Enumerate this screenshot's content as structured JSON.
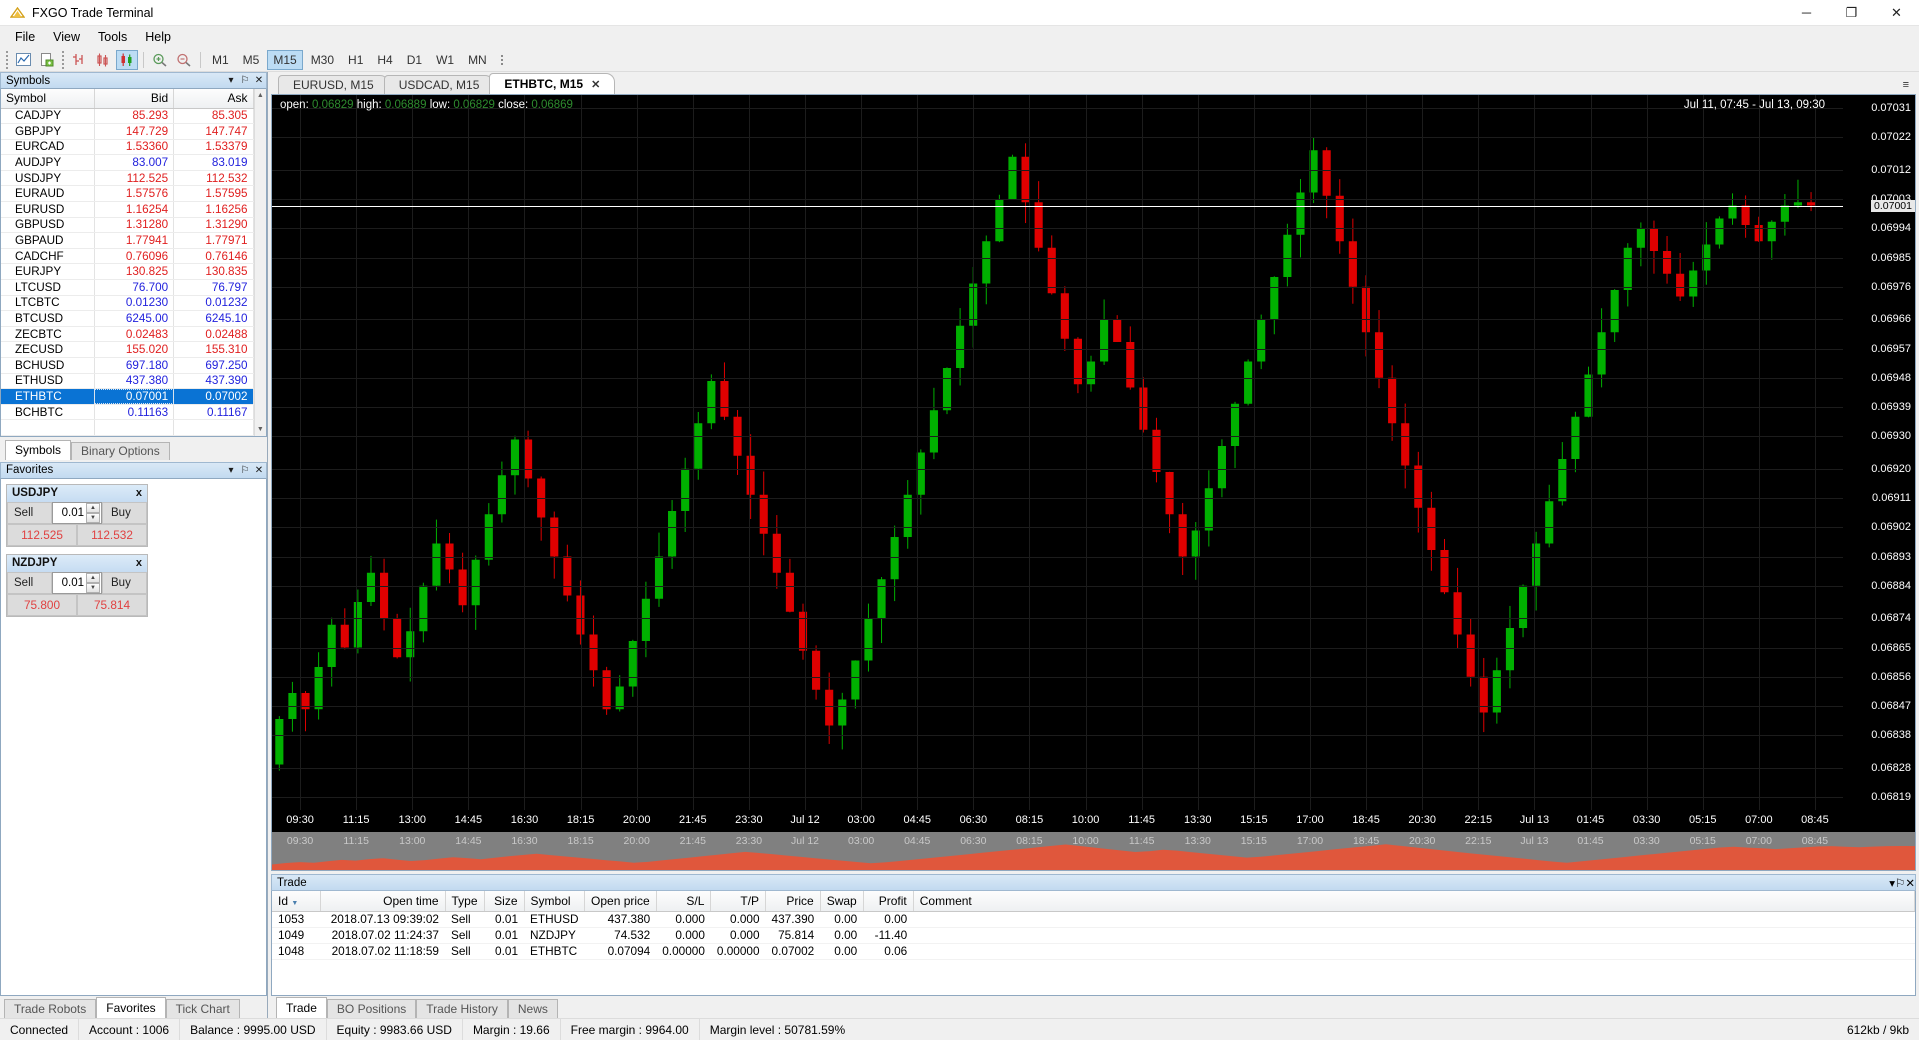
{
  "window": {
    "title": "FXGO Trade Terminal",
    "minimize": "─",
    "maximize": "❐",
    "close": "✕"
  },
  "menu": {
    "items": [
      "File",
      "View",
      "Tools",
      "Help"
    ]
  },
  "toolbar": {
    "chart_icon": "chart-icon",
    "new_chart_icon": "new-chart-icon",
    "bar_chart_icon": "bar-chart-icon",
    "line_chart_icon": "line-chart-icon",
    "candle_chart_icon": "candlestick-icon",
    "zoom_in_icon": "zoom-in-icon",
    "zoom_out_icon": "zoom-out-icon",
    "timeframes": [
      "M1",
      "M5",
      "M15",
      "M30",
      "H1",
      "H4",
      "D1",
      "W1",
      "MN"
    ],
    "active_timeframe": "M15"
  },
  "symbols_panel": {
    "title": "Symbols",
    "collapse": "▾",
    "pin": "⚐",
    "close": "✕",
    "columns": [
      "Symbol",
      "Bid",
      "Ask"
    ],
    "selected": "ETHBTC",
    "rows": [
      {
        "symbol": "CADJPY",
        "bid": "85.293",
        "ask": "85.305",
        "bid_dir": "down",
        "ask_dir": "down"
      },
      {
        "symbol": "GBPJPY",
        "bid": "147.729",
        "ask": "147.747",
        "bid_dir": "down",
        "ask_dir": "down"
      },
      {
        "symbol": "EURCAD",
        "bid": "1.53360",
        "ask": "1.53379",
        "bid_dir": "down",
        "ask_dir": "down"
      },
      {
        "symbol": "AUDJPY",
        "bid": "83.007",
        "ask": "83.019",
        "bid_dir": "up",
        "ask_dir": "up"
      },
      {
        "symbol": "USDJPY",
        "bid": "112.525",
        "ask": "112.532",
        "bid_dir": "down",
        "ask_dir": "down"
      },
      {
        "symbol": "EURAUD",
        "bid": "1.57576",
        "ask": "1.57595",
        "bid_dir": "down",
        "ask_dir": "down"
      },
      {
        "symbol": "EURUSD",
        "bid": "1.16254",
        "ask": "1.16256",
        "bid_dir": "down",
        "ask_dir": "down"
      },
      {
        "symbol": "GBPUSD",
        "bid": "1.31280",
        "ask": "1.31290",
        "bid_dir": "down",
        "ask_dir": "down"
      },
      {
        "symbol": "GBPAUD",
        "bid": "1.77941",
        "ask": "1.77971",
        "bid_dir": "down",
        "ask_dir": "down"
      },
      {
        "symbol": "CADCHF",
        "bid": "0.76096",
        "ask": "0.76146",
        "bid_dir": "down",
        "ask_dir": "down"
      },
      {
        "symbol": "EURJPY",
        "bid": "130.825",
        "ask": "130.835",
        "bid_dir": "down",
        "ask_dir": "down"
      },
      {
        "symbol": "LTCUSD",
        "bid": "76.700",
        "ask": "76.797",
        "bid_dir": "up",
        "ask_dir": "up"
      },
      {
        "symbol": "LTCBTC",
        "bid": "0.01230",
        "ask": "0.01232",
        "bid_dir": "up",
        "ask_dir": "up"
      },
      {
        "symbol": "BTCUSD",
        "bid": "6245.00",
        "ask": "6245.10",
        "bid_dir": "up",
        "ask_dir": "up"
      },
      {
        "symbol": "ZECBTC",
        "bid": "0.02483",
        "ask": "0.02488",
        "bid_dir": "down",
        "ask_dir": "down"
      },
      {
        "symbol": "ZECUSD",
        "bid": "155.020",
        "ask": "155.310",
        "bid_dir": "down",
        "ask_dir": "down"
      },
      {
        "symbol": "BCHUSD",
        "bid": "697.180",
        "ask": "697.250",
        "bid_dir": "up",
        "ask_dir": "up"
      },
      {
        "symbol": "ETHUSD",
        "bid": "437.380",
        "ask": "437.390",
        "bid_dir": "up",
        "ask_dir": "up"
      },
      {
        "symbol": "ETHBTC",
        "bid": "0.07001",
        "ask": "0.07002",
        "bid_dir": "up",
        "ask_dir": "up"
      },
      {
        "symbol": "BCHBTC",
        "bid": "0.11163",
        "ask": "0.11167",
        "bid_dir": "up",
        "ask_dir": "up"
      }
    ],
    "tabs": [
      "Symbols",
      "Binary Options"
    ],
    "active_tab": "Symbols"
  },
  "favorites_panel": {
    "title": "Favorites",
    "collapse": "▾",
    "pin": "⚐",
    "close": "✕",
    "close_widget": "x",
    "sell_label": "Sell",
    "buy_label": "Buy",
    "spin_up": "▲",
    "spin_down": "▼",
    "widgets": [
      {
        "symbol": "USDJPY",
        "volume": "0.01",
        "sell_price": "112.525",
        "buy_price": "112.532"
      },
      {
        "symbol": "NZDJPY",
        "volume": "0.01",
        "sell_price": "75.800",
        "buy_price": "75.814"
      }
    ]
  },
  "left_bottom_tabs": {
    "items": [
      "Trade Robots",
      "Favorites",
      "Tick Chart"
    ],
    "active": "Favorites"
  },
  "chart_tabs": {
    "items": [
      "EURUSD, M15",
      "USDCAD, M15",
      "ETHBTC, M15"
    ],
    "active": "ETHBTC, M15",
    "close": "✕",
    "menu_icon": "tab-list-icon"
  },
  "chart": {
    "ohlc": {
      "open_label": "open:",
      "open": "0.06829",
      "high_label": "high:",
      "high": "0.06889",
      "low_label": "low:",
      "low": "0.06829",
      "close_label": "close:",
      "close": "0.06869"
    },
    "date_range": "Jul 11, 07:45 - Jul 13, 09:30",
    "current_price": "0.07001",
    "price_ticks": [
      "0.07031",
      "0.07022",
      "0.07012",
      "0.07003",
      "0.06994",
      "0.06985",
      "0.06976",
      "0.06966",
      "0.06957",
      "0.06948",
      "0.06939",
      "0.06930",
      "0.06920",
      "0.06911",
      "0.06902",
      "0.06893",
      "0.06884",
      "0.06874",
      "0.06865",
      "0.06856",
      "0.06847",
      "0.06838",
      "0.06828",
      "0.06819"
    ],
    "time_ticks": [
      "09:30",
      "11:15",
      "13:00",
      "14:45",
      "16:30",
      "18:15",
      "20:00",
      "21:45",
      "23:30",
      "Jul 12",
      "03:00",
      "04:45",
      "06:30",
      "08:15",
      "10:00",
      "11:45",
      "13:30",
      "15:15",
      "17:00",
      "18:45",
      "20:30",
      "22:15",
      "Jul 13",
      "01:45",
      "03:30",
      "05:15",
      "07:00",
      "08:45"
    ],
    "colors": {
      "up": "#00b000",
      "down": "#e00000",
      "background": "#000000",
      "grid": "#1c1c1c",
      "price_line": "#ffffff",
      "nav": "#e0573c"
    }
  },
  "chart_data": {
    "type": "candlestick",
    "symbol": "ETHBTC",
    "timeframe": "M15",
    "title": "ETHBTC, M15",
    "ylabel": "",
    "xlabel": "",
    "ylim": [
      0.06815,
      0.07035
    ],
    "xlim": [
      "Jul 11 07:45",
      "Jul 13 09:30"
    ],
    "grid": true,
    "legend": "none",
    "last_close": 0.07001,
    "closes": [
      0.06829,
      0.06843,
      0.06851,
      0.06846,
      0.06859,
      0.06872,
      0.06865,
      0.06879,
      0.06888,
      0.06874,
      0.06862,
      0.0687,
      0.06884,
      0.06897,
      0.06889,
      0.06878,
      0.06892,
      0.06906,
      0.06918,
      0.06929,
      0.06917,
      0.06905,
      0.06893,
      0.06881,
      0.06869,
      0.06858,
      0.06846,
      0.06853,
      0.06867,
      0.0688,
      0.06893,
      0.06907,
      0.0692,
      0.06934,
      0.06947,
      0.06936,
      0.06924,
      0.06912,
      0.069,
      0.06888,
      0.06876,
      0.06864,
      0.06852,
      0.06841,
      0.06849,
      0.06861,
      0.06874,
      0.06886,
      0.06899,
      0.06912,
      0.06925,
      0.06938,
      0.06951,
      0.06964,
      0.06977,
      0.0699,
      0.07003,
      0.07016,
      0.07002,
      0.06988,
      0.06974,
      0.0696,
      0.06946,
      0.06953,
      0.06966,
      0.06959,
      0.06945,
      0.06932,
      0.06919,
      0.06906,
      0.06893,
      0.06901,
      0.06914,
      0.06927,
      0.0694,
      0.06953,
      0.06966,
      0.06979,
      0.06992,
      0.07005,
      0.07018,
      0.07004,
      0.0699,
      0.06976,
      0.06962,
      0.06948,
      0.06934,
      0.06921,
      0.06908,
      0.06895,
      0.06882,
      0.06869,
      0.06856,
      0.06845,
      0.06858,
      0.06871,
      0.06884,
      0.06897,
      0.0691,
      0.06923,
      0.06936,
      0.06949,
      0.06962,
      0.06975,
      0.06988,
      0.06994,
      0.06987,
      0.0698,
      0.06973,
      0.06981,
      0.06989,
      0.06997,
      0.07001,
      0.06995,
      0.0699,
      0.06996,
      0.07001,
      0.07002,
      0.07001
    ]
  },
  "trade_panel": {
    "title": "Trade",
    "collapse": "▾",
    "pin": "⚐",
    "close": "✕",
    "columns": [
      "Id",
      "Open time",
      "Type",
      "Size",
      "Symbol",
      "Open price",
      "S/L",
      "T/P",
      "Price",
      "Swap",
      "Profit",
      "Comment"
    ],
    "sort_column": "Id",
    "rows": [
      {
        "id": "1053",
        "open_time": "2018.07.13 09:39:02",
        "type": "Sell",
        "size": "0.01",
        "symbol": "ETHUSD",
        "open_price": "437.380",
        "sl": "0.000",
        "tp": "0.000",
        "price": "437.390",
        "swap": "0.00",
        "profit": "0.00",
        "comment": ""
      },
      {
        "id": "1049",
        "open_time": "2018.07.02 11:24:37",
        "type": "Sell",
        "size": "0.01",
        "symbol": "NZDJPY",
        "open_price": "74.532",
        "sl": "0.000",
        "tp": "0.000",
        "price": "75.814",
        "swap": "0.00",
        "profit": "-11.40",
        "comment": ""
      },
      {
        "id": "1048",
        "open_time": "2018.07.02 11:18:59",
        "type": "Sell",
        "size": "0.01",
        "symbol": "ETHBTC",
        "open_price": "0.07094",
        "sl": "0.00000",
        "tp": "0.00000",
        "price": "0.07002",
        "swap": "0.00",
        "profit": "0.06",
        "comment": ""
      }
    ],
    "tabs": [
      "Trade",
      "BO Positions",
      "Trade History",
      "News"
    ],
    "active_tab": "Trade"
  },
  "status_bar": {
    "connection": "Connected",
    "account": "Account : 1006",
    "balance": "Balance : 9995.00 USD",
    "equity": "Equity : 9983.66 USD",
    "margin": "Margin : 19.66",
    "free_margin": "Free margin : 9964.00",
    "margin_level": "Margin level : 50781.59%",
    "traffic": "612kb / 9kb"
  }
}
